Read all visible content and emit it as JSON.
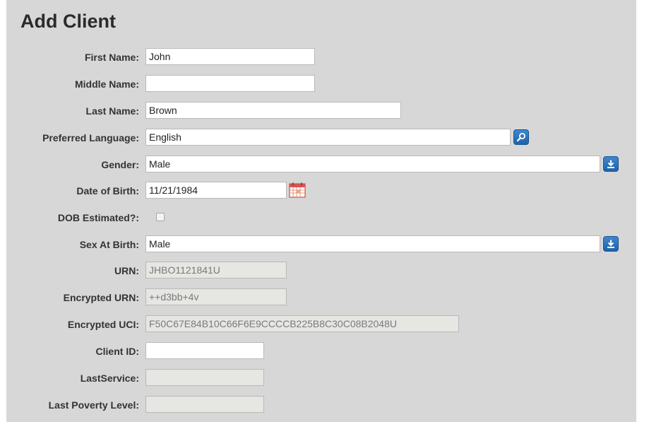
{
  "page": {
    "title": "Add Client"
  },
  "form": {
    "first_name": {
      "label": "First Name:",
      "value": "John"
    },
    "middle_name": {
      "label": "Middle Name:",
      "value": ""
    },
    "last_name": {
      "label": "Last Name:",
      "value": "Brown"
    },
    "preferred_language": {
      "label": "Preferred Language:",
      "value": "English",
      "lookup_icon": "magnifier-icon"
    },
    "gender": {
      "label": "Gender:",
      "value": "Male",
      "dropdown_icon": "download-arrow-icon"
    },
    "date_of_birth": {
      "label": "Date of Birth:",
      "value": "11/21/1984",
      "calendar_icon": "calendar-icon"
    },
    "dob_estimated": {
      "label": "DOB Estimated?:",
      "checked": false
    },
    "sex_at_birth": {
      "label": "Sex At Birth:",
      "value": "Male",
      "dropdown_icon": "download-arrow-icon"
    },
    "urn": {
      "label": "URN:",
      "value": "JHBO1121841U"
    },
    "encrypted_urn": {
      "label": "Encrypted URN:",
      "value": "++d3bb+4v"
    },
    "encrypted_uci": {
      "label": "Encrypted UCI:",
      "value": "F50C67E84B10C66F6E9CCCCB225B8C30C08B2048U"
    },
    "client_id": {
      "label": "Client ID:",
      "value": ""
    },
    "last_service": {
      "label": "LastService:",
      "value": ""
    },
    "last_poverty_level": {
      "label": "Last Poverty Level:",
      "value": ""
    }
  },
  "colors": {
    "panel_background": "#d7d7d7",
    "button_blue": "#2a6fb8",
    "readonly_field": "#e6e6e3"
  }
}
